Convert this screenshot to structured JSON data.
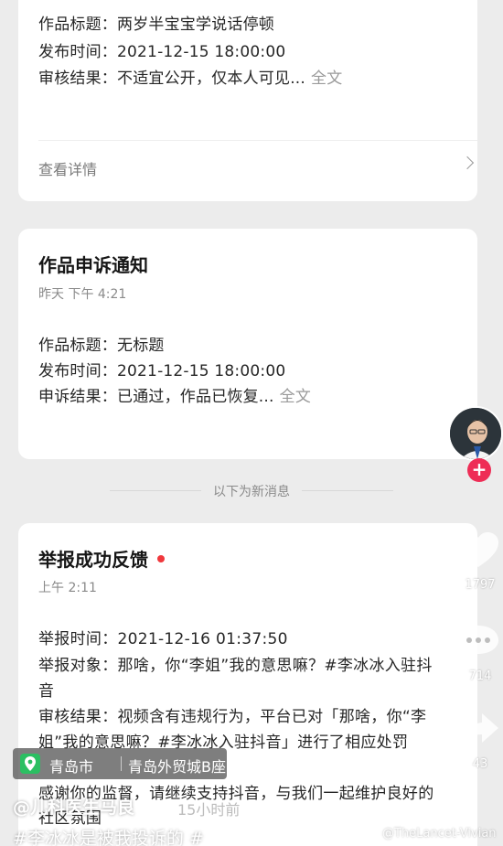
{
  "card1": {
    "rows": [
      {
        "label": "作品标题：",
        "value": "两岁半宝宝学说话停顿"
      },
      {
        "label": "发布时间：",
        "value": "2021-12-15 18:00:00"
      },
      {
        "label": "审核结果：",
        "value": "不适宜公开，仅本人可见..."
      }
    ],
    "full_text": "全文",
    "detail_link": "查看详情"
  },
  "card2": {
    "title": "作品申诉通知",
    "time": "昨天 下午 4:21",
    "rows": [
      {
        "label": "作品标题：",
        "value": "无标题"
      },
      {
        "label": "发布时间：",
        "value": "2021-12-15 18:00:00"
      },
      {
        "label": "申诉结果：",
        "value": "已通过，作品已恢复..."
      }
    ],
    "full_text": "全文"
  },
  "new_messages_divider": "以下为新消息",
  "card3": {
    "title": "举报成功反馈",
    "time": "上午 2:11",
    "report_time": "举报时间：2021-12-16 01:37:50",
    "report_target_1": "举报对象：那啥，你“李姐”我的意思嘛？#李冰冰入驻抖",
    "report_target_2": "音",
    "review_1": "审核结果：视频含有违规行为，平台已对「那啥，你“李",
    "review_2": "姐”我的意思嘛？#李冰冰入驻抖音」进行了相应处罚",
    "thanks_1": "感谢你的监督，请继续支持抖音，与我们一起维护良好的",
    "thanks_2": "社区氛围"
  },
  "overlay": {
    "like_count": "1797",
    "comment_count": "714",
    "share_count": "43",
    "location_city": "青岛市",
    "location_place": "青岛外贸城B座",
    "author": "@儿科医生马良",
    "caption": "#李冰冰是被我投诉的 #",
    "time_ago": "15小时前",
    "watermark": "@TheLancet-Vivian"
  },
  "colors": {
    "accent_red": "#f0383c",
    "plus_button": "#ee2d56",
    "location_green": "#2bbf62"
  }
}
